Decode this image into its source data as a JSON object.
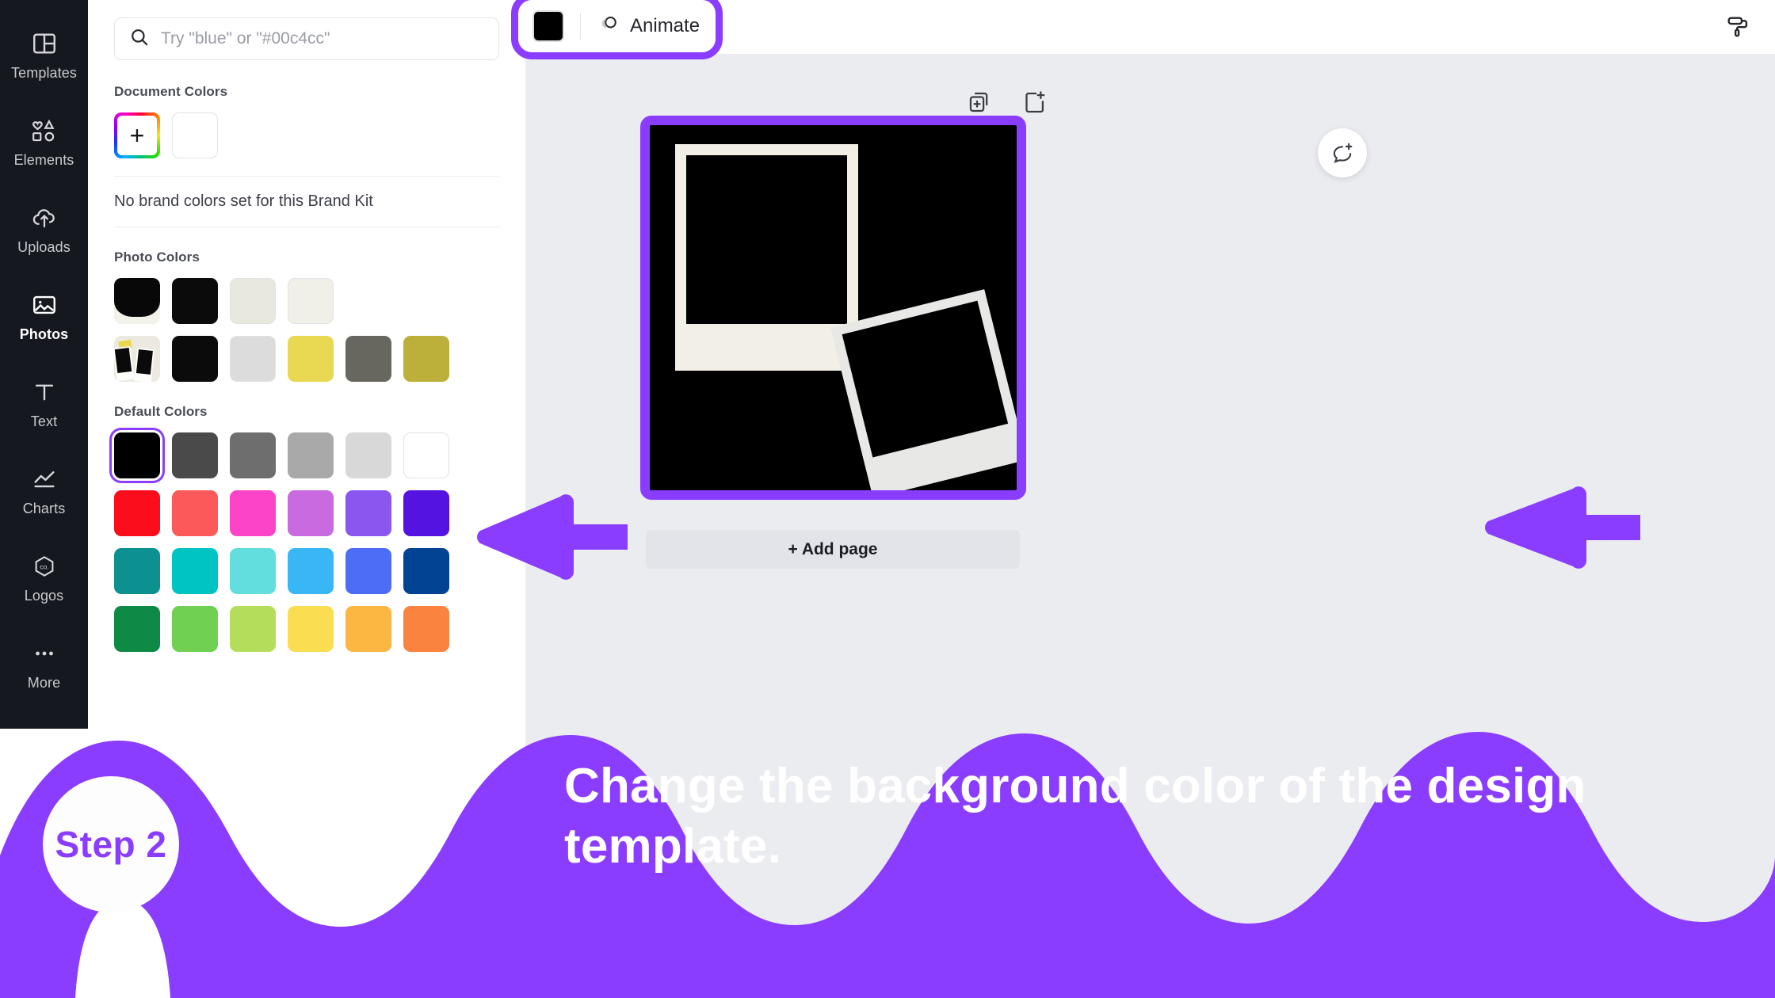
{
  "sidebar": {
    "items": [
      {
        "label": "Templates",
        "icon": "templates-icon",
        "active": false
      },
      {
        "label": "Elements",
        "icon": "elements-icon",
        "active": false
      },
      {
        "label": "Uploads",
        "icon": "uploads-icon",
        "active": false
      },
      {
        "label": "Photos",
        "icon": "photos-icon",
        "active": true
      },
      {
        "label": "Text",
        "icon": "text-icon",
        "active": false
      },
      {
        "label": "Charts",
        "icon": "charts-icon",
        "active": false
      },
      {
        "label": "Logos",
        "icon": "logos-icon",
        "active": false
      },
      {
        "label": "More",
        "icon": "more-icon",
        "active": false
      }
    ]
  },
  "search": {
    "placeholder": "Try \"blue\" or \"#00c4cc\"",
    "value": "",
    "icon": "search-icon"
  },
  "panel": {
    "document_colors_title": "Document Colors",
    "add_color_label": "+",
    "document_colors": [
      "#ffffff"
    ],
    "brand_kit_note": "No brand colors set for this Brand Kit",
    "photo_colors_title": "Photo Colors",
    "photo_colors_row1": [
      "#0b0b0b",
      "#e9e8de",
      "#f0efe8"
    ],
    "photo_colors_row2": [
      "#0b0b0b",
      "#dcdcdc",
      "#e8d852",
      "#67665f",
      "#bcb03a"
    ],
    "default_colors_title": "Default Colors",
    "default_colors": [
      [
        "#000000",
        "#4a4a4a",
        "#6e6e6e",
        "#a9a9a9",
        "#d8d8d8",
        "#ffffff"
      ],
      [
        "#fc0d1b",
        "#fc5a5a",
        "#fb44c8",
        "#c96ae0",
        "#8b56f0",
        "#5413e0"
      ],
      [
        "#0c9190",
        "#00c4c4",
        "#62dede",
        "#38b6f6",
        "#4d6df7",
        "#024493"
      ],
      [
        "#0e8a45",
        "#6fd051",
        "#b5dd5c",
        "#fbdd52",
        "#fcb742",
        "#fb8340"
      ]
    ],
    "selected_default_color": "#000000"
  },
  "toolbar": {
    "doc_color_swatch": "#000000",
    "animate_label": "Animate",
    "animate_icon": "animate-icon",
    "paint_roller_icon": "paint-roller-icon"
  },
  "canvas": {
    "duplicate_page_icon": "duplicate-page-icon",
    "add_page_icon": "add-page-icon",
    "comment_icon": "add-comment-icon",
    "page_background": "#000000",
    "selection_color": "#8b3dff",
    "add_page_label": "+ Add page"
  },
  "annotations": {
    "arrows": [
      {
        "name": "arrow-to-color-swatch",
        "direction": "left"
      },
      {
        "name": "arrow-to-canvas",
        "direction": "left"
      }
    ],
    "arrow_color": "#8b3dff"
  },
  "overlay": {
    "step_badge": "Step 2",
    "caption": "Change the background color of the design template.",
    "wave_color": "#8b3dff",
    "badge_text_color": "#8b3dff"
  }
}
